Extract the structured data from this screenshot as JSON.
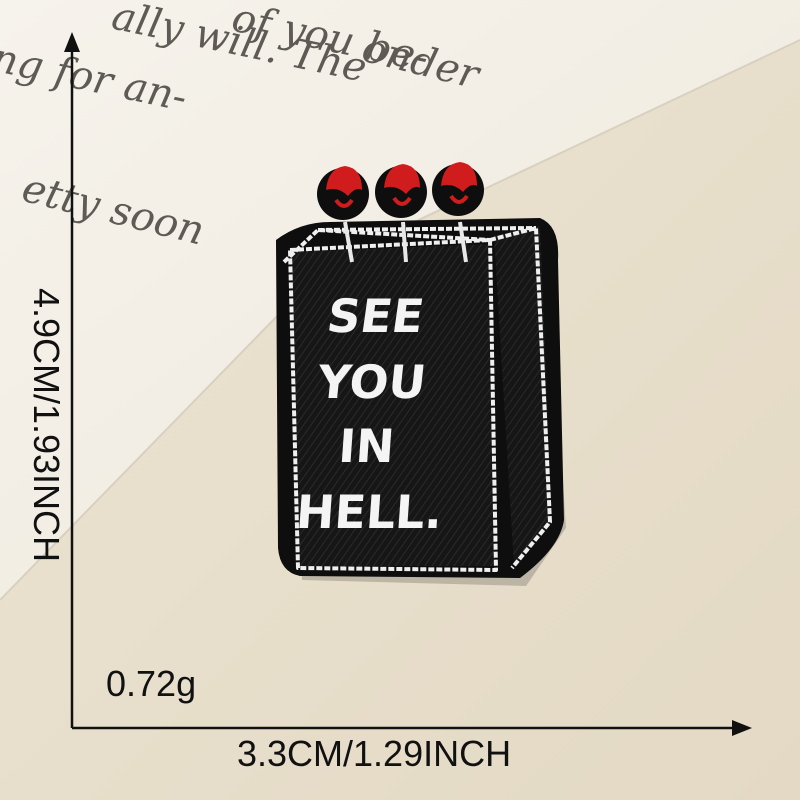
{
  "dimensions": {
    "height_label": "4.9CM/1.93INCH",
    "width_label": "3.3CM/1.29INCH",
    "weight_label": "0.72g"
  },
  "patch": {
    "text_lines": [
      "SEE",
      "YOU",
      "IN",
      "HELL."
    ]
  },
  "background_script_lines": [
    "ally will. The",
    "ng for an-",
    "etty soon",
    "of you be-",
    "onder"
  ],
  "colors": {
    "background": "#e9e1d0",
    "paper": "#f3efe6",
    "patch_fill": "#141414",
    "stitch": "#f2f2f2",
    "balloons": "#d01c1c",
    "ink": "#111111"
  }
}
